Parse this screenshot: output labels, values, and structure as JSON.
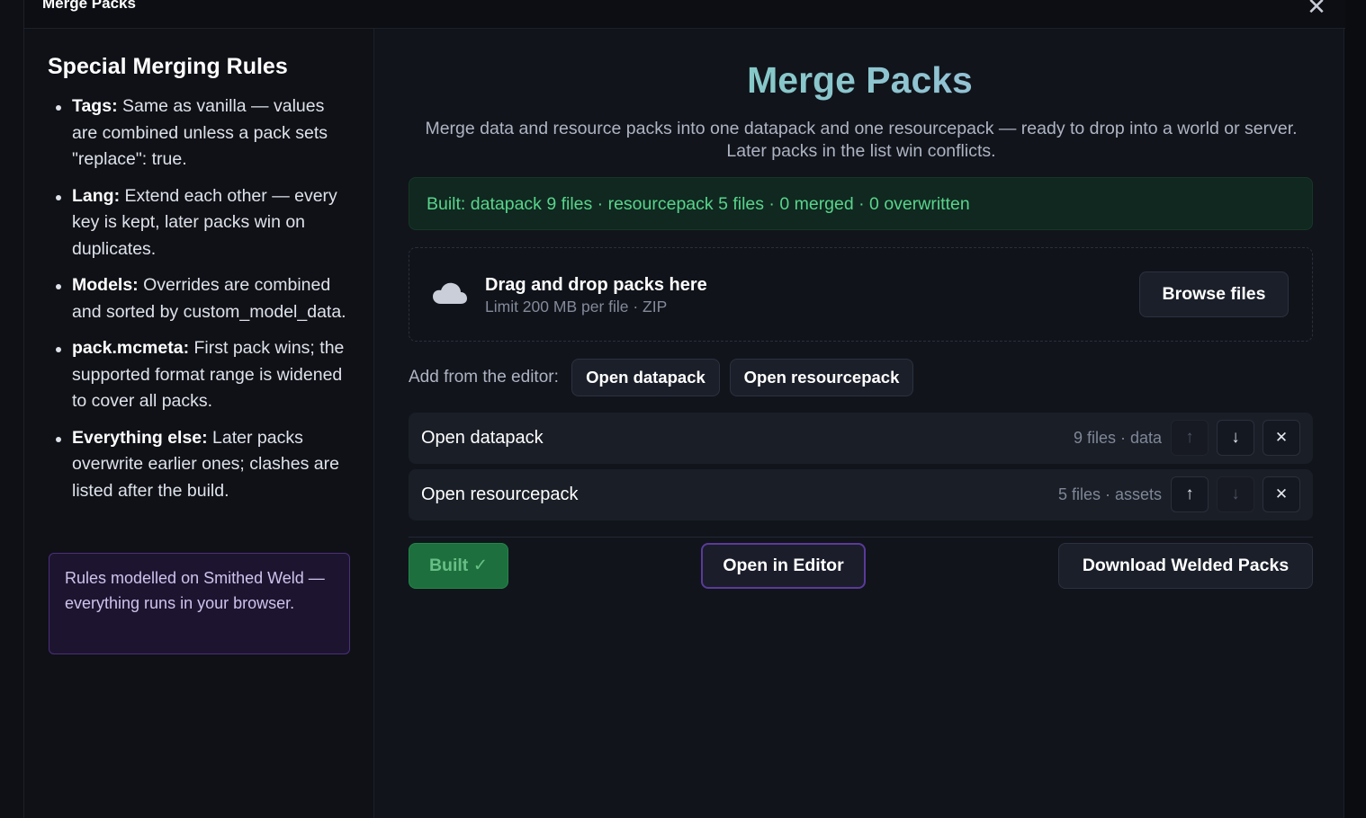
{
  "modal": {
    "title": "Merge Packs",
    "close_symbol": "✕"
  },
  "sidebar": {
    "title": "Special Merging Rules",
    "rules": [
      {
        "term": "Tags:",
        "text": " Same as vanilla — values are combined unless a pack sets \"replace\": true."
      },
      {
        "term": "Lang:",
        "text": " Extend each other — every key is kept, later packs win on duplicates."
      },
      {
        "term": "Models:",
        "text": " Overrides are combined and sorted by custom_model_data."
      },
      {
        "term": "pack.mcmeta:",
        "text": " First pack wins; the supported format range is widened to cover all packs."
      },
      {
        "term": "Everything else:",
        "text": " Later packs overwrite earlier ones; clashes are listed after the build."
      }
    ],
    "note": "Rules modelled on Smithed Weld — everything runs in your browser."
  },
  "main": {
    "title": "Merge Packs",
    "subtitle": "Merge data and resource packs into one datapack and one resourcepack — ready to drop into a world or server. Later packs in the list win conflicts.",
    "status": "Built: datapack 9 files · resourcepack 5 files · 0 merged · 0 overwritten",
    "dropzone": {
      "icon": "cloud-icon",
      "title": "Drag and drop packs here",
      "subtitle": "Limit 200 MB per file · ZIP",
      "browse_label": "Browse files"
    },
    "add_from_editor": {
      "label": "Add from the editor:",
      "buttons": [
        "Open datapack",
        "Open resourcepack"
      ]
    },
    "packs": [
      {
        "name": "Open datapack",
        "meta": "9 files · data",
        "up_enabled": false,
        "down_enabled": true
      },
      {
        "name": "Open resourcepack",
        "meta": "5 files · assets",
        "up_enabled": true,
        "down_enabled": false
      }
    ],
    "icons": {
      "up": "↑",
      "down": "↓",
      "remove": "✕"
    },
    "actions": {
      "built_label": "Built ✓",
      "open_editor_label": "Open in Editor",
      "download_label": "Download Welded Packs"
    }
  },
  "colors": {
    "accent_green": "#58d48c",
    "title_gradient_start": "#6fd3b4",
    "title_gradient_end": "#a9b7e8",
    "note_purple": "#4b2f7a"
  }
}
